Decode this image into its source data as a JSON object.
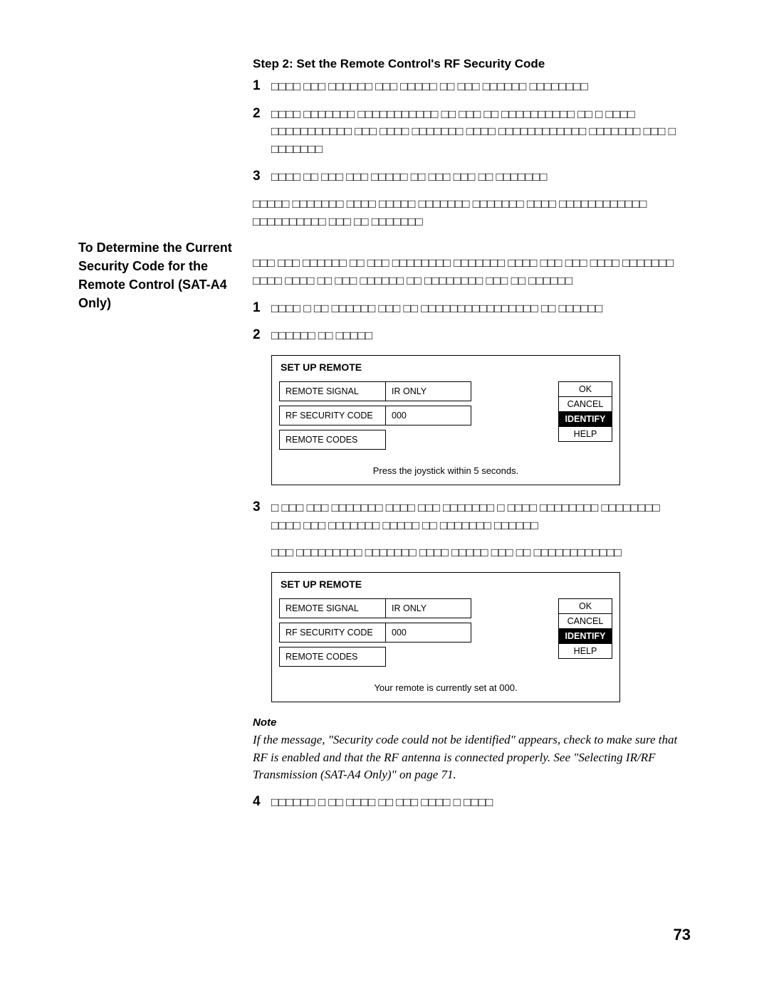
{
  "sidebar": {
    "heading": "To Determine the Current Security Code for the Remote Control (SAT-A4 Only)"
  },
  "step": {
    "heading": "Step 2: Set the Remote Control's RF Security Code",
    "items": [
      {
        "num": "1",
        "text": "□□□□ □□□ □□□□□□ □□□ □□□□□ □□ □□□ □□□□□□ □□□□□□□□"
      },
      {
        "num": "2",
        "text": "□□□□ □□□□□□□ □□□□□□□□□□□ □□ □□□ □□ □□□□□□□□□□ □□ □ □□□□ □□□□□□□□□□□ □□□ □□□□ □□□□□□□ □□□□ □□□□□□□□□□□□ □□□□□□□ □□□ □ □□□□□□□"
      },
      {
        "num": "3",
        "text": "□□□□ □□ □□□ □□□ □□□□□ □□ □□□ □□□ □□ □□□□□□□"
      }
    ],
    "post_para": "□□□□□ □□□□□□□ □□□□ □□□□□ □□□□□□□ □□□□□□□ □□□□ □□□□□□□□□□□□ □□□□□□□□□□ □□□ □□ □□□□□□□"
  },
  "main": {
    "intro": "□□□ □□□ □□□□□□ □□ □□□ □□□□□□□□ □□□□□□□ □□□□ □□□ □□□ □□□□ □□□□□□□ □□□□ □□□□ □□ □□□ □□□□□□ □□ □□□□□□□□ □□□ □□ □□□□□□",
    "items_a": [
      {
        "num": "1",
        "text": "□□□□ □ □□ □□□□□□ □□□ □□ □□□□□□□□□□□□□□□□ □□ □□□□□□"
      },
      {
        "num": "2",
        "text": "□□□□□□ □□ □□□□□"
      }
    ],
    "items_b": [
      {
        "num": "3",
        "text": "□ □□□ □□□ □□□□□□□ □□□□ □□□ □□□□□□□ □ □□□□ □□□□□□□□ □□□□□□□□ □□□□ □□□ □□□□□□□ □□□□□ □□ □□□□□□□ □□□□□□"
      }
    ],
    "between_b": "□□□ □□□□□□□□□ □□□□□□□ □□□□ □□□□□ □□□ □□ □□□□□□□□□□□□",
    "items_c": [
      {
        "num": "4",
        "text": "□□□□□□ □ □□ □□□□ □□ □□□ □□□□ □ □□□□"
      }
    ]
  },
  "panel1": {
    "title": "SET UP REMOTE",
    "rows": {
      "remote_signal_label": "REMOTE SIGNAL",
      "remote_signal_value": "IR ONLY",
      "rf_code_label": "RF SECURITY CODE",
      "rf_code_value": "000",
      "remote_codes_label": "REMOTE CODES"
    },
    "buttons": {
      "ok": "OK",
      "cancel": "CANCEL",
      "identify": "IDENTIFY",
      "help": "HELP"
    },
    "status": "Press the joystick within 5 seconds."
  },
  "panel2": {
    "title": "SET UP REMOTE",
    "rows": {
      "remote_signal_label": "REMOTE SIGNAL",
      "remote_signal_value": "IR ONLY",
      "rf_code_label": "RF SECURITY CODE",
      "rf_code_value": "000",
      "remote_codes_label": "REMOTE CODES"
    },
    "buttons": {
      "ok": "OK",
      "cancel": "CANCEL",
      "identify": "IDENTIFY",
      "help": "HELP"
    },
    "status": "Your remote is currently set at 000."
  },
  "note": {
    "label": "Note",
    "body": "If the message, \"Security code could not be identified\" appears, check to make sure that RF is enabled and that the RF antenna is connected properly. See \"Selecting IR/RF Transmission (SAT-A4 Only)\" on page 71."
  },
  "page_number": "73"
}
